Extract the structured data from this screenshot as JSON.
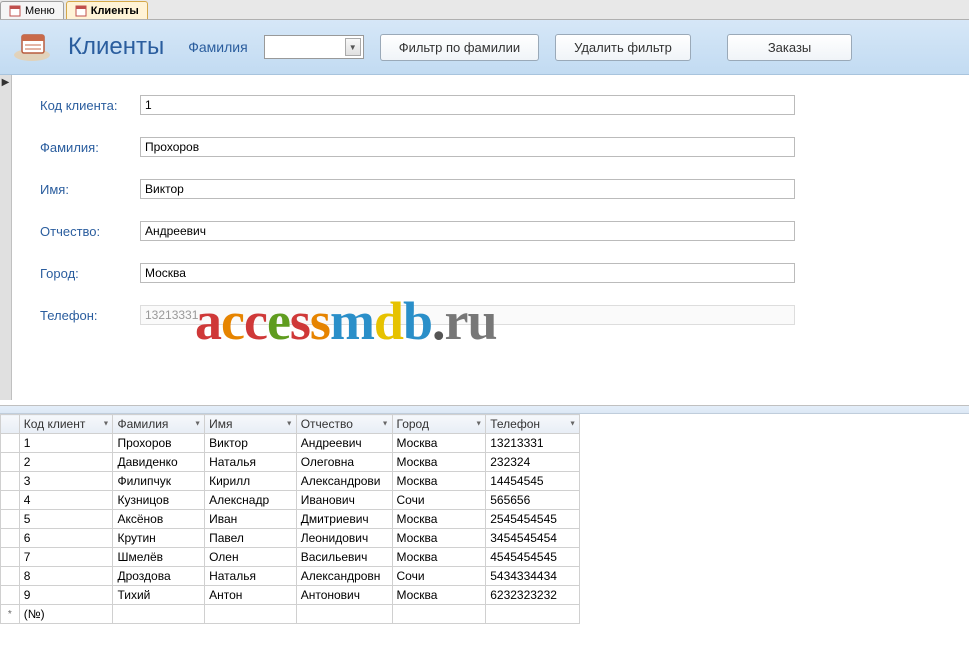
{
  "tabs": [
    {
      "label": "Меню",
      "active": false
    },
    {
      "label": "Клиенты",
      "active": true
    }
  ],
  "header": {
    "title": "Клиенты",
    "combo_label": "Фамилия",
    "filter_btn": "Фильтр по фамилии",
    "clear_filter_btn": "Удалить фильтр",
    "orders_btn": "Заказы"
  },
  "form": {
    "labels": {
      "id": "Код клиента:",
      "surname": "Фамилия:",
      "name": "Имя:",
      "patronymic": "Отчество:",
      "city": "Город:",
      "phone": "Телефон:"
    },
    "values": {
      "id": "1",
      "surname": "Прохоров",
      "name": "Виктор",
      "patronymic": "Андреевич",
      "city": "Москва",
      "phone": "13213331"
    }
  },
  "watermark": {
    "text": "accessmdb.ru"
  },
  "grid": {
    "columns": [
      "Код клиент",
      "Фамилия",
      "Имя",
      "Отчество",
      "Город",
      "Телефон"
    ],
    "new_row_placeholder": "(№)",
    "rows": [
      {
        "id": "1",
        "surname": "Прохоров",
        "name": "Виктор",
        "patronymic": "Андреевич",
        "city": "Москва",
        "phone": "13213331"
      },
      {
        "id": "2",
        "surname": "Давиденко",
        "name": "Наталья",
        "patronymic": "Олеговна",
        "city": "Москва",
        "phone": "232324"
      },
      {
        "id": "3",
        "surname": "Филипчук",
        "name": "Кирилл",
        "patronymic": "Александрови",
        "city": "Москва",
        "phone": "14454545"
      },
      {
        "id": "4",
        "surname": "Кузницов",
        "name": "Алекснадр",
        "patronymic": "Иванович",
        "city": "Сочи",
        "phone": "565656"
      },
      {
        "id": "5",
        "surname": "Аксёнов",
        "name": "Иван",
        "patronymic": "Дмитриевич",
        "city": "Москва",
        "phone": "2545454545"
      },
      {
        "id": "6",
        "surname": "Крутин",
        "name": "Павел",
        "patronymic": "Леонидович",
        "city": "Москва",
        "phone": "3454545454"
      },
      {
        "id": "7",
        "surname": "Шмелёв",
        "name": "Олен",
        "patronymic": "Васильевич",
        "city": "Москва",
        "phone": "4545454545"
      },
      {
        "id": "8",
        "surname": "Дроздова",
        "name": "Наталья",
        "patronymic": "Александровн",
        "city": "Сочи",
        "phone": "5434334434"
      },
      {
        "id": "9",
        "surname": "Тихий",
        "name": "Антон",
        "patronymic": "Антонович",
        "city": "Москва",
        "phone": "6232323232"
      }
    ]
  }
}
